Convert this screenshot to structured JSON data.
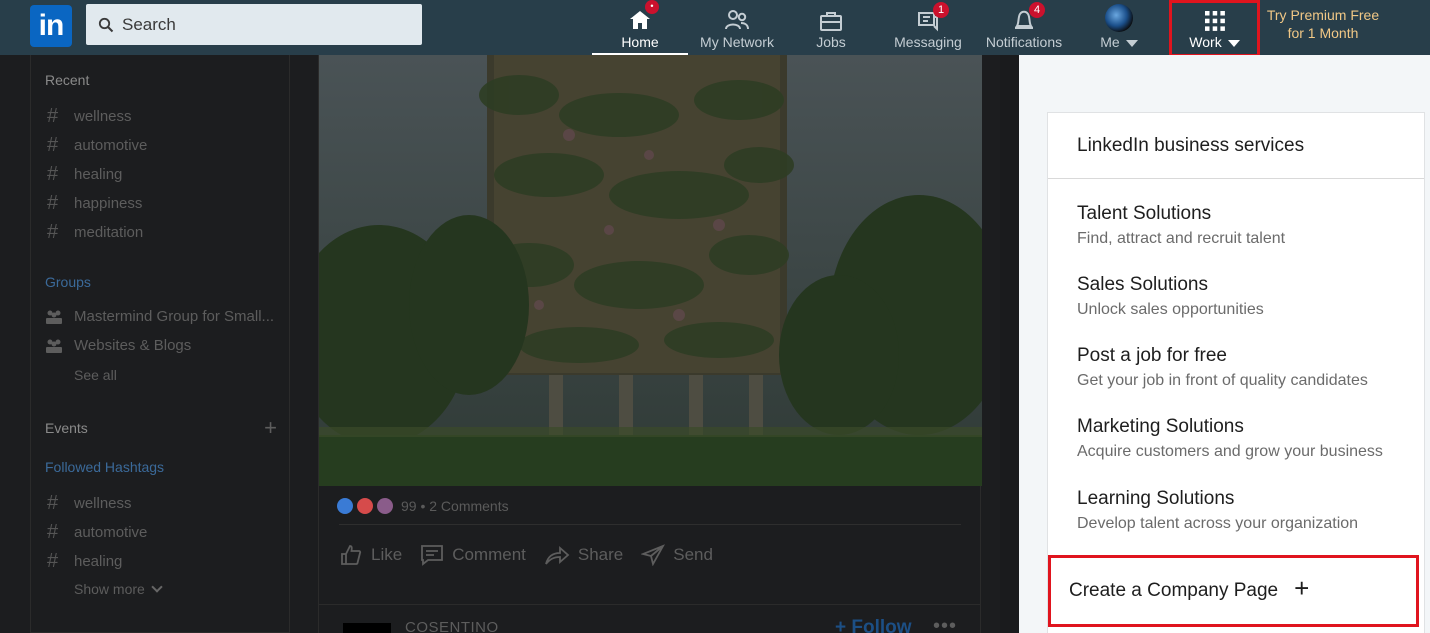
{
  "nav": {
    "search_placeholder": "Search",
    "home": "Home",
    "my_network": "My Network",
    "jobs": "Jobs",
    "messaging": "Messaging",
    "messaging_badge": "1",
    "notifications": "Notifications",
    "notifications_badge": "4",
    "home_badge": "•",
    "me": "Me",
    "work": "Work",
    "premium": "Try Premium Free for 1 Month"
  },
  "sidebar": {
    "recent_heading": "Recent",
    "recent": [
      "wellness",
      "automotive",
      "healing",
      "happiness",
      "meditation"
    ],
    "groups_heading": "Groups",
    "groups": [
      "Mastermind Group for Small...",
      "Websites & Blogs"
    ],
    "see_all": "See all",
    "events_heading": "Events",
    "followed_heading": "Followed Hashtags",
    "followed": [
      "wellness",
      "automotive",
      "healing"
    ],
    "show_more": "Show more"
  },
  "post": {
    "reactions_text": "99 • 2 Comments",
    "like": "Like",
    "comment": "Comment",
    "share": "Share",
    "send": "Send"
  },
  "next_post": {
    "company": "COSENTINO",
    "follow": "+ Follow",
    "more": "•••"
  },
  "work_menu": {
    "title": "LinkedIn business services",
    "items": [
      {
        "title": "Talent Solutions",
        "subtitle": "Find, attract and recruit talent"
      },
      {
        "title": "Sales Solutions",
        "subtitle": "Unlock sales opportunities"
      },
      {
        "title": "Post a job for free",
        "subtitle": "Get your job in front of quality candidates"
      },
      {
        "title": "Marketing Solutions",
        "subtitle": "Acquire customers and grow your business"
      },
      {
        "title": "Learning Solutions",
        "subtitle": "Develop talent across your organization"
      }
    ],
    "create_page": "Create a Company Page",
    "create_plus": "+"
  },
  "colors": {
    "nav_bg": "#283e4a",
    "accent_blue": "#0a66c2",
    "badge_red": "#cb112d",
    "highlight_red": "#e0141e",
    "premium_gold": "#f1c886"
  }
}
